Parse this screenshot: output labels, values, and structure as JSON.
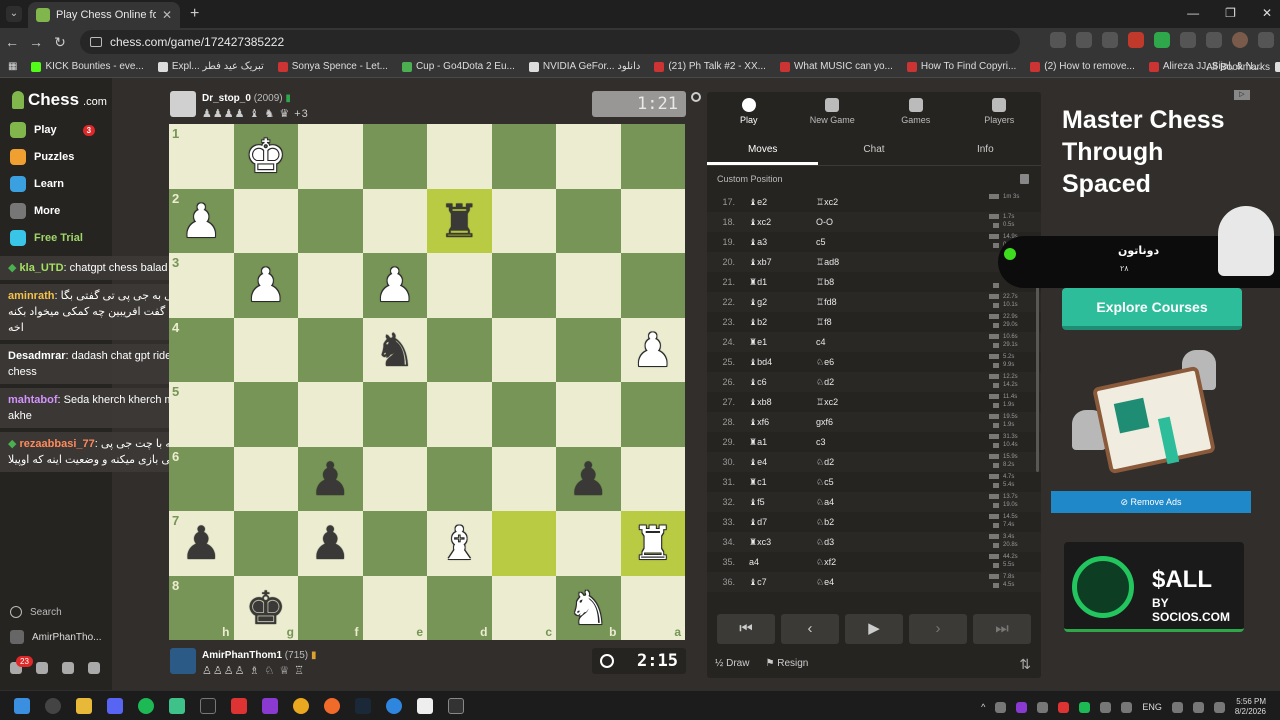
{
  "browser": {
    "tab_title": "Play Chess Online for FREE - 2 P",
    "url": "chess.com/game/172427385222",
    "bookmarks": [
      {
        "label": "KICK Bounties - eve...",
        "color": "k"
      },
      {
        "label": "Expl... تبریک عید فطر",
        "color": "w"
      },
      {
        "label": "Sonya Spence - Let...",
        "color": "r"
      },
      {
        "label": "Cup - Go4Dota 2 Eu...",
        "color": "g"
      },
      {
        "label": "NVIDIA GeFor... دانلود",
        "color": "w"
      },
      {
        "label": "(21) Ph Talk #2 - XX...",
        "color": "r"
      },
      {
        "label": "What MUSIC can yo...",
        "color": "r"
      },
      {
        "label": "How To Find Copyri...",
        "color": "r"
      },
      {
        "label": "(2) How to remove...",
        "color": "r"
      },
      {
        "label": "Alireza JJ, Sijal, & N...",
        "color": "r"
      },
      {
        "label": "فروشگاه اینترنتی ایلا...",
        "color": "w"
      }
    ],
    "all_bookmarks": "All Bookmarks"
  },
  "sidebar": {
    "logo": "Chess",
    "logo_suffix": ".com",
    "items": [
      {
        "label": "Play",
        "badge": "3",
        "color": "#81b64c"
      },
      {
        "label": "Puzzles",
        "color": "#f0a030"
      },
      {
        "label": "Learn",
        "color": "#3aa0e0"
      },
      {
        "label": "More",
        "color": "#777"
      },
      {
        "label": "Free Trial",
        "color": "#39c5e8"
      }
    ],
    "search": "Search",
    "user": "AmirPhanTho...",
    "notif_badge": "23"
  },
  "chat": [
    {
      "user": "kla_UTD",
      "text": ": chatgpt chess balad ni",
      "cls": "b"
    },
    {
      "user": "aminrath",
      "text": ": مثلی به جی پی تی گفتی بگا رفتم گفت افریبین چه کمکی میخواد بکنه اخه",
      "cls": "a"
    },
    {
      "user": "Desadmrar",
      "text": ": dadash chat gpt ride to chess",
      "cls": "w"
    },
    {
      "user": "mahtabof",
      "text": ": Seda kherch kherch mide akhe",
      "cls": "d"
    },
    {
      "user": "rezaabbasi_77",
      "text": ": اگه با چت جی پی تی بازی میکنه و وضعیت اینه که اوپیلا",
      "cls": "e"
    }
  ],
  "opponent": {
    "name": "Dr_stop_0",
    "rating": "(2009)",
    "captured": "♟♟♟♟ ♝ ♞ ♛ +3",
    "clock": "1:21"
  },
  "me": {
    "name": "AmirPhanThom1",
    "rating": "(715)",
    "captured": "♙♙♙♙ ♗ ♘ ♕ ♖",
    "clock": "2:15"
  },
  "board": {
    "ranks": [
      "1",
      "2",
      "3",
      "4",
      "5",
      "6",
      "7",
      "8"
    ],
    "files": [
      "h",
      "g",
      "f",
      "e",
      "d",
      "c",
      "b",
      "a"
    ],
    "pieces": [
      {
        "sq": "g1",
        "p": "♚",
        "c": "w"
      },
      {
        "sq": "h2",
        "p": "♟",
        "c": "w"
      },
      {
        "sq": "d2",
        "p": "♜",
        "c": "b"
      },
      {
        "sq": "g3",
        "p": "♟",
        "c": "w"
      },
      {
        "sq": "e3",
        "p": "♟",
        "c": "w"
      },
      {
        "sq": "e4",
        "p": "♞",
        "c": "b"
      },
      {
        "sq": "a4",
        "p": "♟",
        "c": "w"
      },
      {
        "sq": "f6",
        "p": "♟",
        "c": "b"
      },
      {
        "sq": "b6",
        "p": "♟",
        "c": "b"
      },
      {
        "sq": "h7",
        "p": "♟",
        "c": "b"
      },
      {
        "sq": "f7",
        "p": "♟",
        "c": "b"
      },
      {
        "sq": "d7",
        "p": "♝",
        "c": "w"
      },
      {
        "sq": "a7",
        "p": "♜",
        "c": "w"
      },
      {
        "sq": "g8",
        "p": "♚",
        "c": "b"
      },
      {
        "sq": "b8",
        "p": "♞",
        "c": "w"
      }
    ],
    "highlight": {
      "d2": "hl",
      "c7": "hl",
      "a7": "hl"
    }
  },
  "panel": {
    "tabs": [
      "Play",
      "New Game",
      "Games",
      "Players"
    ],
    "subtabs": [
      "Moves",
      "Chat",
      "Info"
    ],
    "custom_position": "Custom Position",
    "moves": [
      {
        "n": "17.",
        "w": "♝e2",
        "b": "♖xc2",
        "t": [
          "1m 3s",
          ""
        ]
      },
      {
        "n": "18.",
        "w": "♝xc2",
        "b": "O-O",
        "t": [
          "1.7s",
          "0.5s"
        ]
      },
      {
        "n": "19.",
        "w": "♝a3",
        "b": "c5",
        "t": [
          "14.9s",
          "0.5s"
        ]
      },
      {
        "n": "20.",
        "w": "♝xb7",
        "b": "♖ad8",
        "t": [
          "",
          ""
        ]
      },
      {
        "n": "21.",
        "w": "♜d1",
        "b": "♖b8",
        "t": [
          "",
          "1.1s"
        ]
      },
      {
        "n": "22.",
        "w": "♝g2",
        "b": "♖fd8",
        "t": [
          "22.7s",
          "10.1s"
        ]
      },
      {
        "n": "23.",
        "w": "♝b2",
        "b": "♖f8",
        "t": [
          "22.9s",
          "29.0s"
        ]
      },
      {
        "n": "24.",
        "w": "♜e1",
        "b": "c4",
        "t": [
          "10.6s",
          "29.1s"
        ]
      },
      {
        "n": "25.",
        "w": "♝bd4",
        "b": "♘e6",
        "t": [
          "5.2s",
          "9.9s"
        ]
      },
      {
        "n": "26.",
        "w": "♝c6",
        "b": "♘d2",
        "t": [
          "12.2s",
          "14.2s"
        ]
      },
      {
        "n": "27.",
        "w": "♝xb8",
        "b": "♖xc2",
        "t": [
          "11.4s",
          "1.9s"
        ]
      },
      {
        "n": "28.",
        "w": "♝xf6",
        "b": "gxf6",
        "t": [
          "19.5s",
          "1.9s"
        ]
      },
      {
        "n": "29.",
        "w": "♜a1",
        "b": "c3",
        "t": [
          "31.3s",
          "10.4s"
        ]
      },
      {
        "n": "30.",
        "w": "♝e4",
        "b": "♘d2",
        "t": [
          "15.9s",
          "8.2s"
        ]
      },
      {
        "n": "31.",
        "w": "♜c1",
        "b": "♘c5",
        "t": [
          "4.7s",
          "5.4s"
        ]
      },
      {
        "n": "32.",
        "w": "♝f5",
        "b": "♘a4",
        "t": [
          "13.7s",
          "19.0s"
        ]
      },
      {
        "n": "33.",
        "w": "♝d7",
        "b": "♘b2",
        "t": [
          "14.5s",
          "7.4s"
        ]
      },
      {
        "n": "34.",
        "w": "♜xc3",
        "b": "♘d3",
        "t": [
          "3.4s",
          "20.8s"
        ]
      },
      {
        "n": "35.",
        "w": "a4",
        "b": "♘xf2",
        "t": [
          "44.2s",
          "5.5s"
        ]
      },
      {
        "n": "36.",
        "w": "♝c7",
        "b": "♘e4",
        "t": [
          "7.8s",
          "4.5s"
        ]
      },
      {
        "n": "37.",
        "w": "♜xa7",
        "b": "",
        "t": [
          "4.5s",
          ""
        ]
      }
    ],
    "draw": "Draw",
    "draw_prefix": "½",
    "resign": "Resign"
  },
  "ad": {
    "title": "Master Chess Through Spaced",
    "overlay_name": "دوناتون",
    "overlay_sub": "۲۸",
    "explore": "Explore Courses",
    "remove_ads": "Remove Ads",
    "token": "$ALL",
    "token_sub": "BY SOCIOS.COM"
  },
  "taskbar": {
    "lang": "ENG",
    "time": "5:56 PM",
    "date": "8/2/2026"
  }
}
